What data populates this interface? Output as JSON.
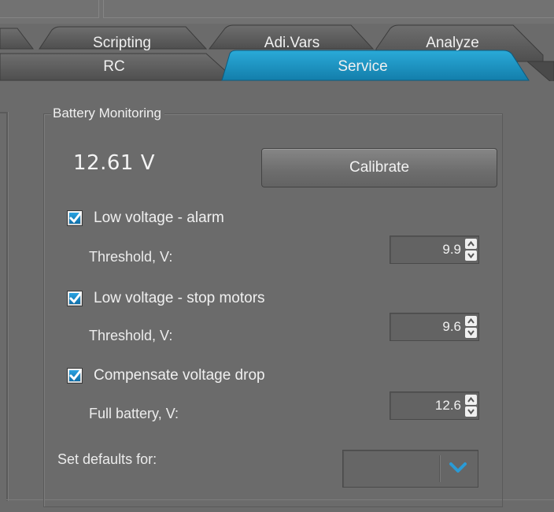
{
  "tabs": {
    "row1": [
      {
        "label": "Scripting"
      },
      {
        "label": "Adi.Vars"
      },
      {
        "label": "Analyze"
      }
    ],
    "row2": [
      {
        "label": "RC",
        "active": false
      },
      {
        "label": "Service",
        "active": true
      }
    ]
  },
  "battery": {
    "group_title": "Battery Monitoring",
    "voltage_readout": "12.61 V",
    "calibrate_label": "Calibrate",
    "low_alarm": {
      "checked": true,
      "label": "Low voltage - alarm",
      "threshold_label": "Threshold, V:",
      "threshold_value": "9.9"
    },
    "low_stop": {
      "checked": true,
      "label": "Low voltage - stop motors",
      "threshold_label": "Threshold, V:",
      "threshold_value": "9.6"
    },
    "compensate": {
      "checked": true,
      "label": "Compensate voltage drop",
      "full_label": "Full battery, V:",
      "full_value": "12.6"
    },
    "defaults_label": "Set defaults for:",
    "defaults_value": ""
  },
  "colors": {
    "accent": "#2aa3e2",
    "active_tab": "#1b93c4",
    "background": "#6b6b6b",
    "text": "#f0f0f0"
  },
  "icons": {
    "check": "checkmark-icon",
    "spin_up": "chevron-up-icon",
    "spin_down": "chevron-down-icon",
    "combo_arrow": "chevron-down-icon"
  }
}
